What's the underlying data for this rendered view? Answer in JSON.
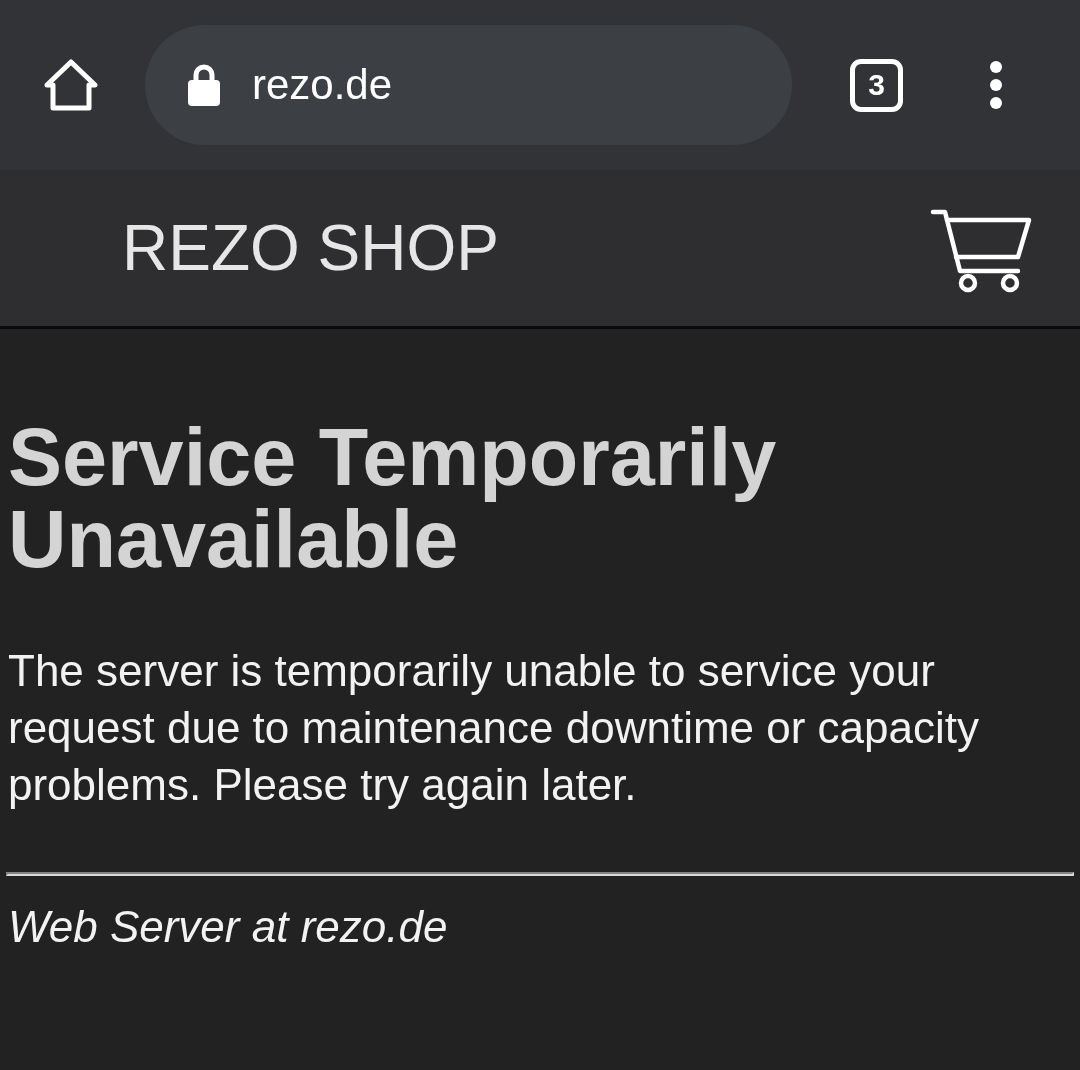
{
  "browser": {
    "secure": true,
    "url": "rezo.de",
    "tab_count": "3"
  },
  "site_header": {
    "logo": "REZO SHOP"
  },
  "page": {
    "heading": "Service Temporarily Unavailable",
    "message": "The server is temporarily unable to service your request due to maintenance downtime or capacity problems. Please try again later.",
    "footer": "Web Server at rezo.de"
  }
}
